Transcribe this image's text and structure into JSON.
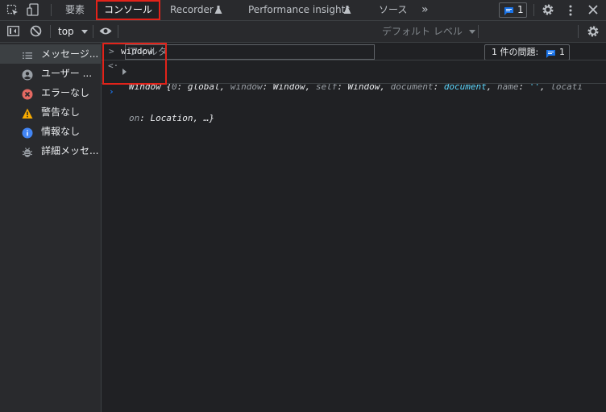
{
  "tabs": {
    "elements": "要素",
    "console": "コンソール",
    "recorder": "Recorder",
    "performance": "Performance insights",
    "sources": "ソース",
    "more": "»"
  },
  "header": {
    "issues_badge": "1"
  },
  "toolbar": {
    "context": "top",
    "filter_placeholder": "フィルタ",
    "levels": "デフォルト レベル",
    "issues_prefix": "1 件の問題:",
    "issues_count": "1"
  },
  "sidebar": {
    "items": [
      {
        "label": "メッセージ...",
        "icon": "list-icon"
      },
      {
        "label": "ユーザー ...",
        "icon": "user-icon"
      },
      {
        "label": "エラーなし",
        "icon": "error-icon"
      },
      {
        "label": "警告なし",
        "icon": "warning-icon"
      },
      {
        "label": "情報なし",
        "icon": "info-icon"
      },
      {
        "label": "詳細メッセ...",
        "icon": "bug-icon"
      }
    ]
  },
  "console": {
    "input": "window",
    "result": {
      "t0": "Window",
      "t1": " {",
      "t2": "0",
      "t3": ": global, ",
      "t4": "window",
      "t5": ": Window, ",
      "t6": "self",
      "t7": ": Window, ",
      "t8": "document",
      "t9": ": ",
      "t10": "document",
      "t11": ", ",
      "t12": "name",
      "t13": ": ",
      "t14": "''",
      "t15": ", ",
      "t16": "locati",
      "l2a": "on",
      "l2b": ": Location, …}"
    }
  },
  "colors": {
    "highlight": "#e2231a",
    "accent_blue": "#1a73e8",
    "error": "#e46962",
    "warning": "#f9ab00",
    "info": "#4285f4",
    "string": "#5cd5fb"
  }
}
